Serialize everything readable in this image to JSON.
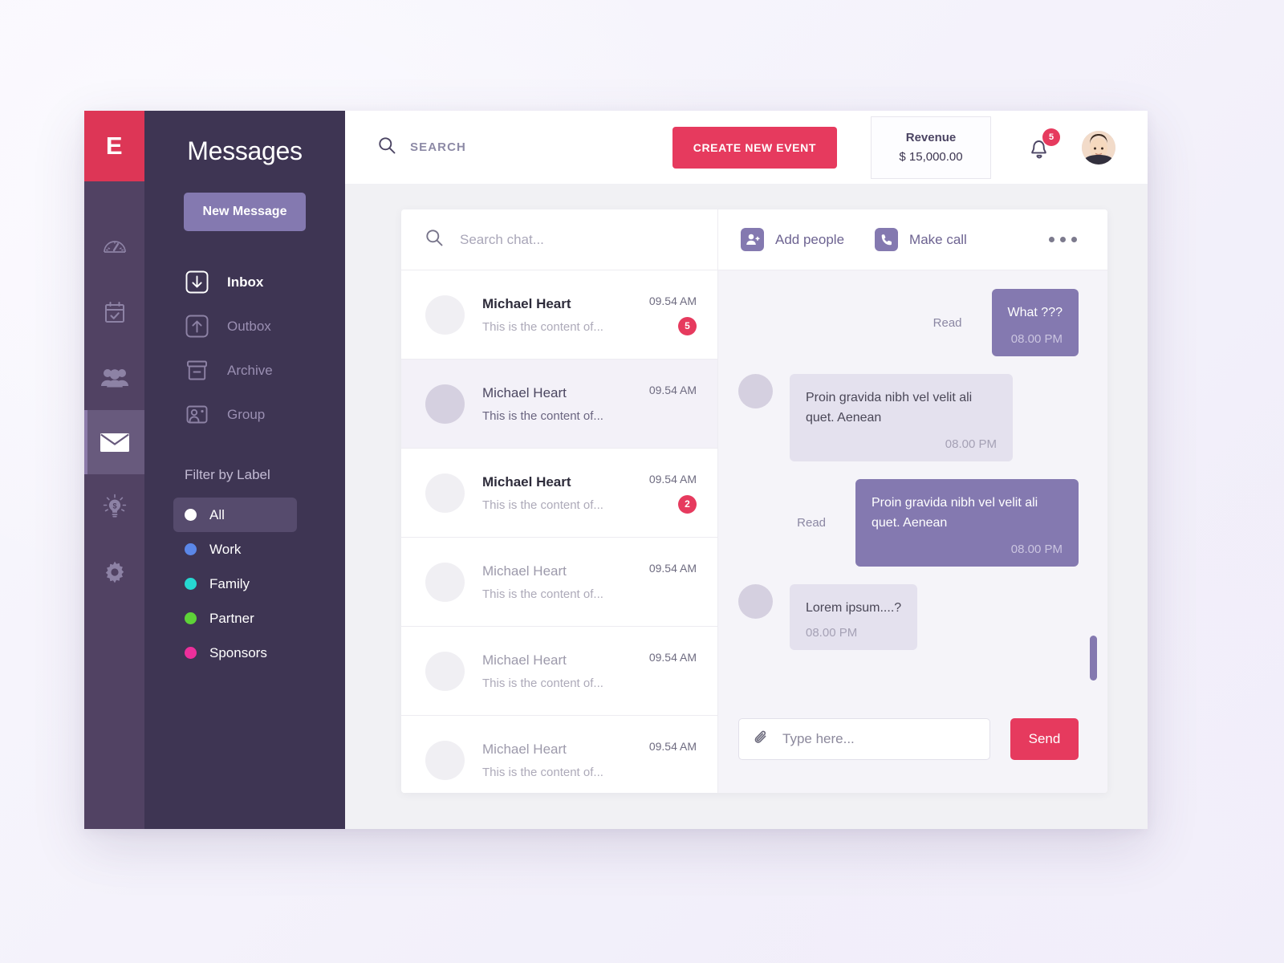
{
  "brand": {
    "logo_letter": "E",
    "accent_red": "#e63a5e",
    "accent_purple": "#8479b0",
    "sidebar_dark": "#3e3553",
    "rail_dark": "#514263"
  },
  "rail": {
    "items": [
      {
        "icon": "speedometer-icon",
        "name": "dashboard"
      },
      {
        "icon": "calendar-check-icon",
        "name": "events"
      },
      {
        "icon": "people-group-icon",
        "name": "contacts"
      },
      {
        "icon": "envelope-icon",
        "name": "messages",
        "active": true
      },
      {
        "icon": "lightbulb-dollar-icon",
        "name": "finance"
      },
      {
        "icon": "gear-icon",
        "name": "settings"
      }
    ]
  },
  "sidebar": {
    "title": "Messages",
    "new_message_label": "New Message",
    "nav": [
      {
        "label": "Inbox",
        "icon": "inbox-arrow-down-icon",
        "active": true
      },
      {
        "label": "Outbox",
        "icon": "outbox-arrow-up-icon",
        "active": false
      },
      {
        "label": "Archive",
        "icon": "archive-box-icon",
        "active": false
      },
      {
        "label": "Group",
        "icon": "group-card-icon",
        "active": false
      }
    ],
    "filter_title": "Filter by Label",
    "filters": [
      {
        "label": "All",
        "color": "#ffffff",
        "active": true
      },
      {
        "label": "Work",
        "color": "#5b87e8",
        "active": false
      },
      {
        "label": "Family",
        "color": "#26d7d1",
        "active": false
      },
      {
        "label": "Partner",
        "color": "#5ed338",
        "active": false
      },
      {
        "label": "Sponsors",
        "color": "#ec2f9b",
        "active": false
      }
    ]
  },
  "topbar": {
    "search_placeholder": "SEARCH",
    "create_event_label": "CREATE NEW EVENT",
    "revenue_label": "Revenue",
    "revenue_value": "$ 15,000.00",
    "notification_count": "5"
  },
  "chatlist": {
    "search_placeholder": "Search chat...",
    "rows": [
      {
        "name": "Michael Heart",
        "preview": "This is the content of...",
        "time": "09.54 AM",
        "badge": "5",
        "unread": true,
        "selected": false
      },
      {
        "name": "Michael Heart",
        "preview": "This is the content of...",
        "time": "09.54 AM",
        "badge": "",
        "unread": false,
        "selected": true
      },
      {
        "name": "Michael Heart",
        "preview": "This is the content of...",
        "time": "09.54 AM",
        "badge": "2",
        "unread": true,
        "selected": false
      },
      {
        "name": "Michael Heart",
        "preview": "This is the content of...",
        "time": "09.54 AM",
        "badge": "",
        "unread": false,
        "selected": false
      },
      {
        "name": "Michael Heart",
        "preview": "This is the content of...",
        "time": "09.54 AM",
        "badge": "",
        "unread": false,
        "selected": false
      },
      {
        "name": "Michael Heart",
        "preview": "This is the content of...",
        "time": "09.54 AM",
        "badge": "",
        "unread": false,
        "selected": false
      }
    ]
  },
  "conversation": {
    "add_people_label": "Add people",
    "make_call_label": "Make call",
    "more_menu": "more-options",
    "read_label_1": "Read",
    "read_label_2": "Read",
    "messages": [
      {
        "dir": "out",
        "text": "What ???",
        "time": "08.00 PM",
        "status": "Read"
      },
      {
        "dir": "in",
        "text": "Proin gravida nibh vel velit ali quet. Aenean",
        "time": "08.00 PM",
        "status": ""
      },
      {
        "dir": "out",
        "text": "Proin gravida nibh vel velit ali quet. Aenean",
        "time": "08.00 PM",
        "status": "Read"
      },
      {
        "dir": "in",
        "text": "Lorem ipsum....?",
        "time": "08.00 PM",
        "status": ""
      }
    ],
    "input_placeholder": "Type here...",
    "send_label": "Send"
  }
}
